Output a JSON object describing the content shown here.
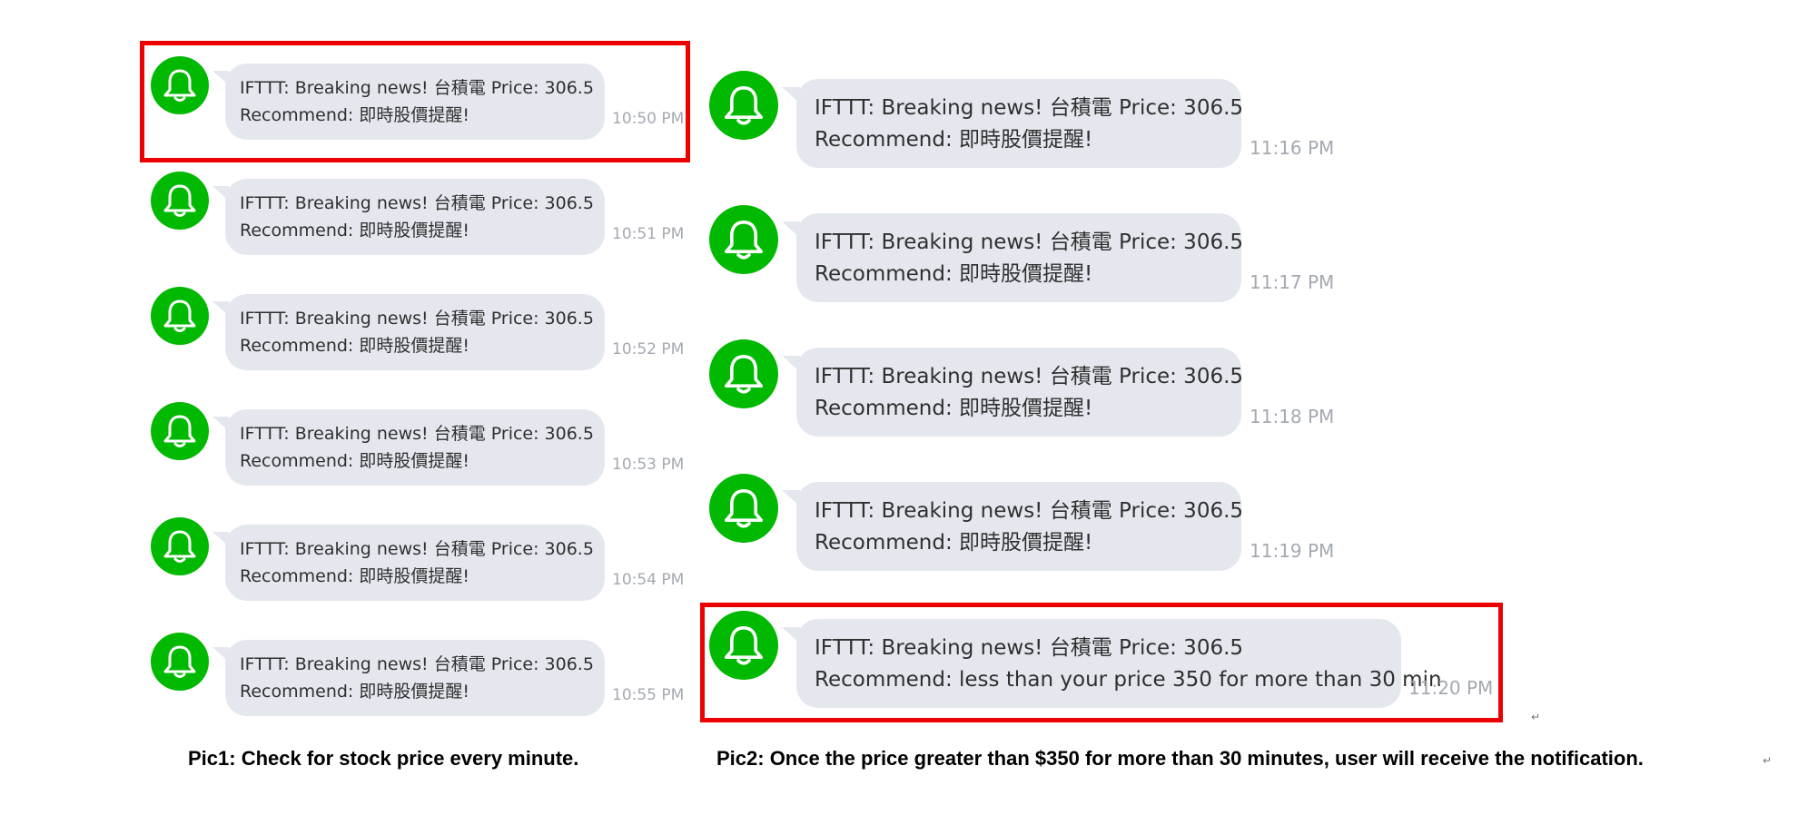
{
  "colors": {
    "avatar": "#00b900",
    "bubble": "#e4e8ee",
    "highlight": "#ec0000",
    "timestamp": "#a4a9b0"
  },
  "avatar_icon": "bell-icon",
  "pic1": {
    "messages": [
      {
        "line1": "IFTTT: Breaking news! 台積電 Price: 306.5",
        "line2": "Recommend: 即時股價提醒!",
        "time": "10:50 PM"
      },
      {
        "line1": "IFTTT: Breaking news! 台積電 Price: 306.5",
        "line2": "Recommend: 即時股價提醒!",
        "time": "10:51 PM"
      },
      {
        "line1": "IFTTT: Breaking news! 台積電 Price: 306.5",
        "line2": "Recommend: 即時股價提醒!",
        "time": "10:52 PM"
      },
      {
        "line1": "IFTTT: Breaking news! 台積電 Price: 306.5",
        "line2": "Recommend: 即時股價提醒!",
        "time": "10:53 PM"
      },
      {
        "line1": "IFTTT: Breaking news! 台積電 Price: 306.5",
        "line2": "Recommend: 即時股價提醒!",
        "time": "10:54 PM"
      },
      {
        "line1": "IFTTT: Breaking news! 台積電 Price: 306.5",
        "line2": "Recommend: 即時股價提醒!",
        "time": "10:55 PM"
      }
    ],
    "caption": "Pic1: Check for stock price every minute."
  },
  "pic2": {
    "messages": [
      {
        "line1": "IFTTT: Breaking news! 台積電 Price: 306.5",
        "line2": "Recommend: 即時股價提醒!",
        "time": "11:16 PM"
      },
      {
        "line1": "IFTTT: Breaking news! 台積電 Price: 306.5",
        "line2": "Recommend: 即時股價提醒!",
        "time": "11:17 PM"
      },
      {
        "line1": "IFTTT: Breaking news! 台積電 Price: 306.5",
        "line2": "Recommend: 即時股價提醒!",
        "time": "11:18 PM"
      },
      {
        "line1": "IFTTT: Breaking news! 台積電 Price: 306.5",
        "line2": "Recommend: 即時股價提醒!",
        "time": "11:19 PM"
      },
      {
        "line1": "IFTTT: Breaking news! 台積電 Price: 306.5",
        "line2": "Recommend: less than your price 350 for more than 30 min",
        "time": "11:20 PM"
      }
    ],
    "caption": "Pic2: Once the price greater than $350 for more than 30 minutes, user will receive the notification."
  }
}
